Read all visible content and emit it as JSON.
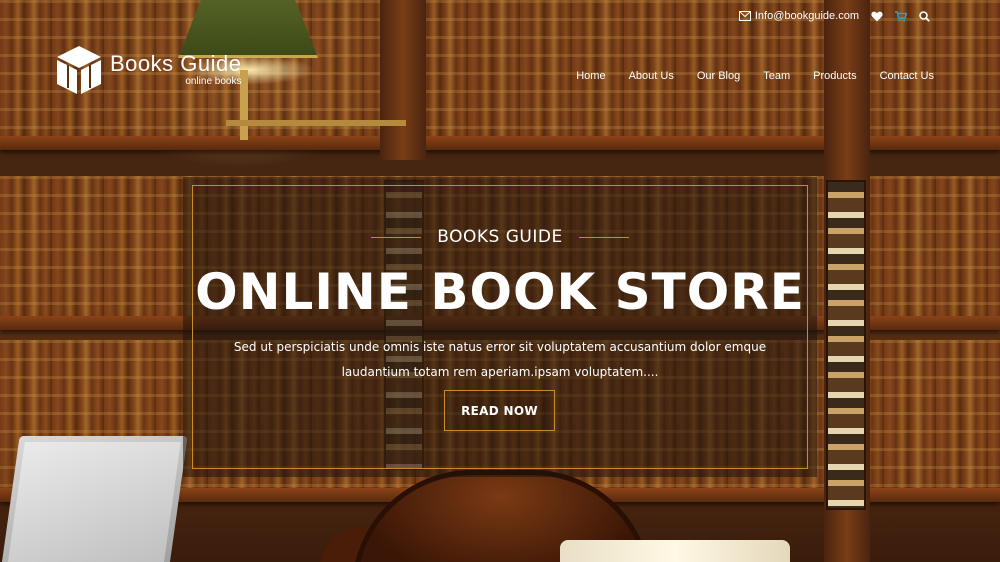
{
  "topbar": {
    "email": "Info@bookguide.com",
    "icons": [
      "envelope-icon",
      "heart-icon",
      "cart-icon",
      "search-icon"
    ]
  },
  "logo": {
    "title": "Books Guide",
    "subtitle": "online books"
  },
  "nav": {
    "items": [
      "Home",
      "About Us",
      "Our Blog",
      "Team",
      "Products",
      "Contact Us"
    ]
  },
  "hero": {
    "kicker": "BOOKS GUIDE",
    "headline": "ONLINE BOOK STORE",
    "description_line1": "Sed ut perspiciatis unde omnis iste natus error sit voluptatem accusantium dolor emque",
    "description_line2": "laudantium totam rem aperiam.ipsam voluptatem....",
    "cta_label": "READ NOW"
  },
  "colors": {
    "accent": "#c98a2a",
    "cart": "#2a9fd6",
    "text": "#ffffff"
  }
}
